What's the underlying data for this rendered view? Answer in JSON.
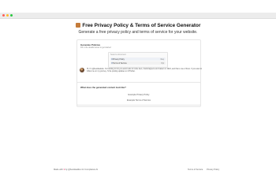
{
  "window": {
    "controls": [
      "close",
      "minimize",
      "maximize"
    ]
  },
  "header": {
    "title_icon": "notebook-emoji",
    "title": "Free Privacy Policy & Terms of Service Generator",
    "subtitle": "Generate a free privacy policy and terms of service for your website."
  },
  "settings": {
    "title": "Generate Policies",
    "description": "Fill in the details below to get started",
    "select": {
      "label": "Select a document",
      "options": [
        {
          "label": "Privacy Policy",
          "tag": "Req"
        },
        {
          "label": "Terms of Service",
          "tag": "Opt"
        }
      ]
    }
  },
  "note": {
    "text": "Hi, I'm @bestdealdev. I'm building 10 tiny & useful tools for indie devs, bootstrappers and makers in 2024, and this is one of them. If you want to follow me on my journey, I'd be posting updates on X/Twitter."
  },
  "results": {
    "title": "What does the generated content look like?",
    "links": [
      "Example Privacy Policy",
      "Example Terms of Service"
    ]
  },
  "footer": {
    "made_by_prefix": "Made with",
    "heart": "♥",
    "made_by_suffix": "by @bestdealdev for Compliance AI",
    "terms": "Terms of Service",
    "privacy": "Privacy Policy"
  }
}
